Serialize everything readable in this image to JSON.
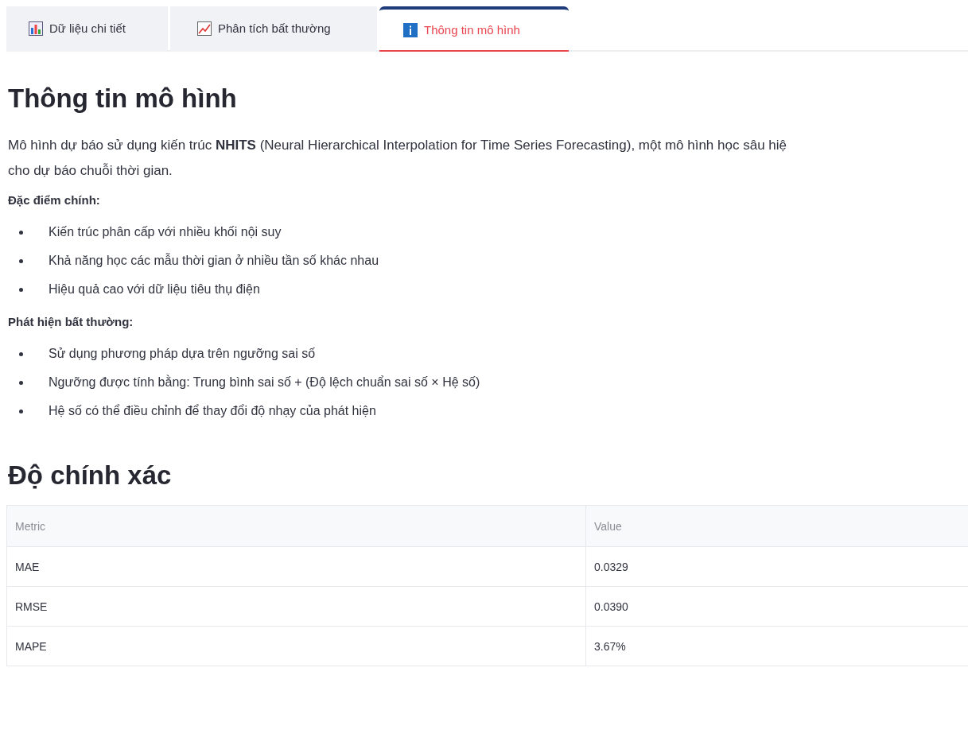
{
  "tabs": [
    {
      "label": "Dữ liệu chi tiết",
      "kind": "bar",
      "selected": false
    },
    {
      "label": "Phân tích bất thường",
      "kind": "line",
      "selected": false
    },
    {
      "label": "Thông tin mô hình",
      "kind": "info",
      "selected": true
    }
  ],
  "title": "Thông tin mô hình",
  "intro": "Mô hình dự báo sử dụng kiến trúc **NHITS** (Neural Hierarchical Interpolation for Time Series Forecasting), một mô hình học sâu hiệ cho dự báo chuỗi thời gian.",
  "sections": [
    {
      "heading": "Đặc điểm chính:",
      "items": [
        "Kiến trúc phân cấp với nhiều khối nội suy",
        "Khả năng học các mẫu thời gian ở nhiều tần số khác nhau",
        "Hiệu quả cao với dữ liệu tiêu thụ điện"
      ]
    },
    {
      "heading": "Phát hiện bất thường:",
      "items": [
        "Sử dụng phương pháp dựa trên ngưỡng sai số",
        "Ngưỡng được tính bằng: Trung bình sai số + (Độ lệch chuẩn sai số × Hệ số)",
        "Hệ số có thể điều chỉnh để thay đổi độ nhạy của phát hiện"
      ]
    }
  ],
  "accuracy_title": "Độ chính xác",
  "table": {
    "columns": [
      "Metric",
      "Value"
    ],
    "rows": [
      [
        "MAE",
        "0.0329"
      ],
      [
        "RMSE",
        "0.0390"
      ],
      [
        "MAPE",
        "3.67%"
      ]
    ]
  }
}
